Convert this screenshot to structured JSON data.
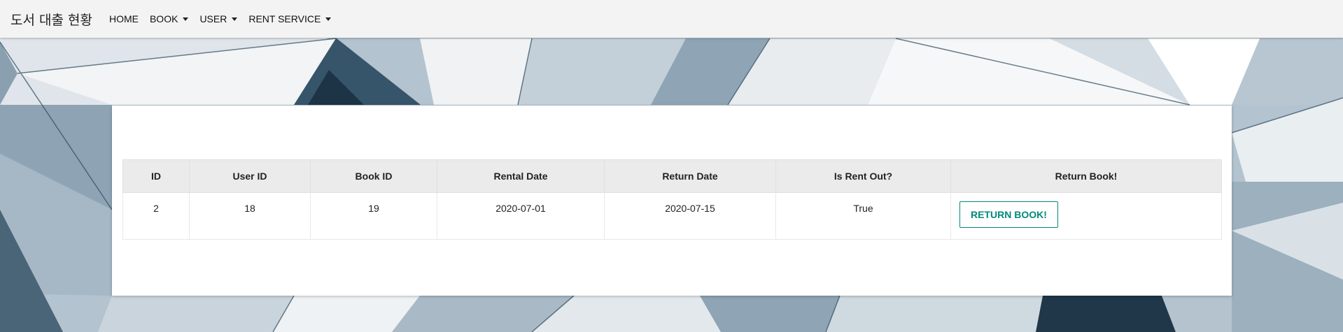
{
  "navbar": {
    "brand": "도서 대출 현황",
    "items": [
      {
        "label": "HOME",
        "dropdown": false
      },
      {
        "label": "BOOK",
        "dropdown": true
      },
      {
        "label": "USER",
        "dropdown": true
      },
      {
        "label": "RENT SERVICE",
        "dropdown": true
      }
    ]
  },
  "table": {
    "headers": [
      "ID",
      "User ID",
      "Book ID",
      "Rental Date",
      "Return Date",
      "Is Rent Out?",
      "Return Book!"
    ],
    "rows": [
      {
        "id": "2",
        "user_id": "18",
        "book_id": "19",
        "rental_date": "2020-07-01",
        "return_date": "2020-07-15",
        "is_rent_out": "True",
        "action_label": "RETURN BOOK!"
      }
    ]
  },
  "colors": {
    "navbar_bg": "#f3f3f3",
    "header_bg": "#ebebeb",
    "accent": "#00897b",
    "background": "#a9bac7"
  }
}
